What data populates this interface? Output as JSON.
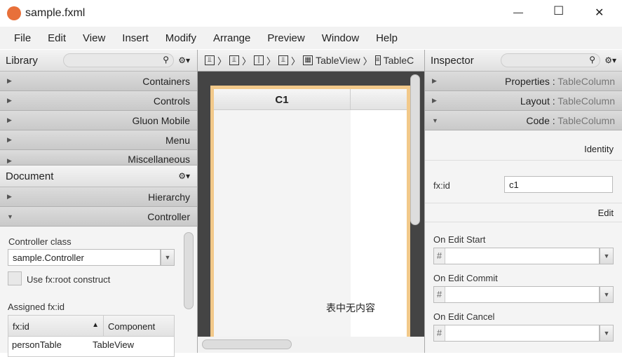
{
  "window": {
    "title": "sample.fxml",
    "minimize": "—",
    "maximize": "☐",
    "close": "✕"
  },
  "menu": [
    "File",
    "Edit",
    "View",
    "Insert",
    "Modify",
    "Arrange",
    "Preview",
    "Window",
    "Help"
  ],
  "library": {
    "title": "Library",
    "sections": [
      "Containers",
      "Controls",
      "Gluon Mobile",
      "Menu",
      "Miscellaneous"
    ]
  },
  "document": {
    "title": "Document",
    "sections": [
      "Hierarchy",
      "Controller"
    ],
    "controller_class_label": "Controller class",
    "controller_class_value": "sample.Controller",
    "use_fx_root": "Use fx:root construct",
    "assigned_label": "Assigned fx:id",
    "table_headers": [
      "fx:id",
      "Component"
    ],
    "rows": [
      [
        "personTable",
        "TableView"
      ]
    ]
  },
  "breadcrumb": {
    "items": [
      "TableView",
      "TableC"
    ]
  },
  "canvas": {
    "column_header": "C1",
    "empty_text": "表中无内容"
  },
  "inspector": {
    "title": "Inspector",
    "sections": [
      {
        "name": "Properties",
        "target": "TableColumn"
      },
      {
        "name": "Layout",
        "target": "TableColumn"
      },
      {
        "name": "Code",
        "target": "TableColumn"
      }
    ],
    "identity": "Identity",
    "fxid_label": "fx:id",
    "fxid_value": "c1",
    "edit": "Edit",
    "handlers": [
      "On Edit Start",
      "On Edit Commit",
      "On Edit Cancel"
    ],
    "hash": "#"
  }
}
